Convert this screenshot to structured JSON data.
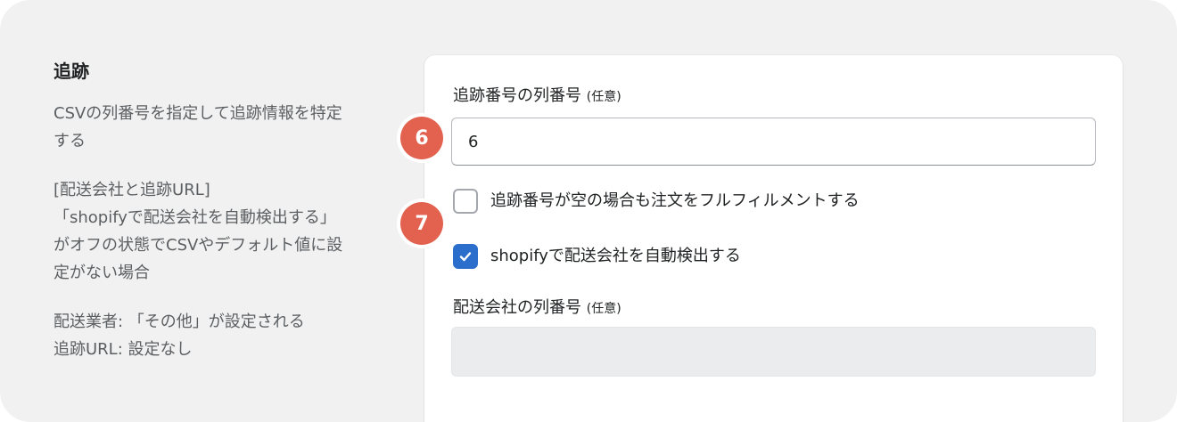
{
  "section": {
    "title": "追跡",
    "description_lines": [
      "CSVの列番号を指定して追跡情報を特定",
      "する"
    ],
    "note_lines": [
      "[配送会社と追跡URL]",
      "「shopifyで配送会社を自動検出する」",
      "がオフの状態でCSVやデフォルト値に設",
      "定がない場合"
    ],
    "defaults_lines": [
      "配送業者: 「その他」が設定される",
      "追跡URL: 設定なし"
    ]
  },
  "form": {
    "tracking_column": {
      "label": "追跡番号の列番号",
      "optional": "(任意)",
      "value": "6"
    },
    "fulfill_empty": {
      "label": "追跡番号が空の場合も注文をフルフィルメントする",
      "checked": false
    },
    "auto_detect": {
      "label": "shopifyで配送会社を自動検出する",
      "checked": true
    },
    "carrier_column": {
      "label": "配送会社の列番号",
      "optional": "(任意)",
      "value": "",
      "disabled": true
    }
  },
  "badges": {
    "badge_6": "6",
    "badge_7": "7"
  },
  "colors": {
    "badge": "#e2614f",
    "checkbox_checked": "#2c6ecb",
    "background": "#f1f1f1",
    "card": "#ffffff"
  }
}
